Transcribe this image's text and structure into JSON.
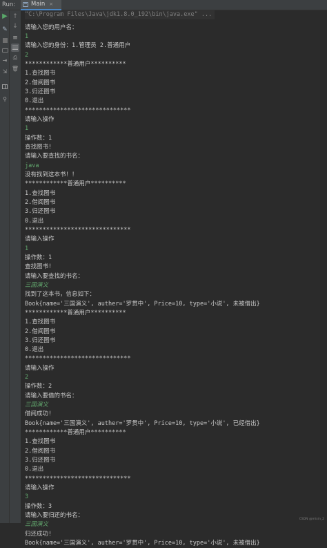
{
  "run_label": "Run:",
  "tab": {
    "label": "Main",
    "close": "×"
  },
  "watermark": "CSDN @mixin_2",
  "console_lines": [
    {
      "text": "\"C:\\Program Files\\Java\\jdk1.8.0_192\\bin\\java.exe\" ...",
      "kind": "cmd"
    },
    {
      "text": "请输入您的用户名：",
      "kind": "out"
    },
    {
      "text": "1",
      "kind": "input"
    },
    {
      "text": "请输入您的身份：1.管理员 2.普通用户",
      "kind": "out"
    },
    {
      "text": "2",
      "kind": "input"
    },
    {
      "text": "************普通用户**********",
      "kind": "out"
    },
    {
      "text": "1.查找图书",
      "kind": "out"
    },
    {
      "text": "2.借阅图书",
      "kind": "out"
    },
    {
      "text": "3.归还图书",
      "kind": "out"
    },
    {
      "text": "0.退出",
      "kind": "out"
    },
    {
      "text": "******************************",
      "kind": "out"
    },
    {
      "text": "请输入操作",
      "kind": "out"
    },
    {
      "text": "1",
      "kind": "input"
    },
    {
      "text": "操作数：1",
      "kind": "out"
    },
    {
      "text": "查找图书!",
      "kind": "out"
    },
    {
      "text": "请输入要查找的书名：",
      "kind": "out"
    },
    {
      "text": "java",
      "kind": "input"
    },
    {
      "text": "没有找到这本书！！",
      "kind": "out"
    },
    {
      "text": "************普通用户**********",
      "kind": "out"
    },
    {
      "text": "1.查找图书",
      "kind": "out"
    },
    {
      "text": "2.借阅图书",
      "kind": "out"
    },
    {
      "text": "3.归还图书",
      "kind": "out"
    },
    {
      "text": "0.退出",
      "kind": "out"
    },
    {
      "text": "******************************",
      "kind": "out"
    },
    {
      "text": "请输入操作",
      "kind": "out"
    },
    {
      "text": "1",
      "kind": "input"
    },
    {
      "text": "操作数：1",
      "kind": "out"
    },
    {
      "text": "查找图书!",
      "kind": "out"
    },
    {
      "text": "请输入要查找的书名：",
      "kind": "out"
    },
    {
      "text": "三国演义",
      "kind": "input-italic"
    },
    {
      "text": "找到了这本书，信息如下：",
      "kind": "out"
    },
    {
      "text": "Book{name='三国演义', auther='罗贯中', Price=10, type='小说', 未被借出}",
      "kind": "out"
    },
    {
      "text": "************普通用户**********",
      "kind": "out"
    },
    {
      "text": "1.查找图书",
      "kind": "out"
    },
    {
      "text": "2.借阅图书",
      "kind": "out"
    },
    {
      "text": "3.归还图书",
      "kind": "out"
    },
    {
      "text": "0.退出",
      "kind": "out"
    },
    {
      "text": "******************************",
      "kind": "out"
    },
    {
      "text": "请输入操作",
      "kind": "out"
    },
    {
      "text": "2",
      "kind": "input"
    },
    {
      "text": "操作数：2",
      "kind": "out"
    },
    {
      "text": "请输入要借的书名：",
      "kind": "out"
    },
    {
      "text": "三国演义",
      "kind": "input-italic"
    },
    {
      "text": "借阅成功!",
      "kind": "out"
    },
    {
      "text": "Book{name='三国演义', auther='罗贯中', Price=10, type='小说', 已经借出}",
      "kind": "out"
    },
    {
      "text": "************普通用户**********",
      "kind": "out"
    },
    {
      "text": "1.查找图书",
      "kind": "out"
    },
    {
      "text": "2.借阅图书",
      "kind": "out"
    },
    {
      "text": "3.归还图书",
      "kind": "out"
    },
    {
      "text": "0.退出",
      "kind": "out"
    },
    {
      "text": "******************************",
      "kind": "out"
    },
    {
      "text": "请输入操作",
      "kind": "out"
    },
    {
      "text": "3",
      "kind": "input"
    },
    {
      "text": "操作数：3",
      "kind": "out"
    },
    {
      "text": "请输入要归还的书名：",
      "kind": "out"
    },
    {
      "text": "三国演义",
      "kind": "input-italic"
    },
    {
      "text": "归还成功!",
      "kind": "out"
    },
    {
      "text": "Book{name='三国演义', auther='罗贯中', Price=10, type='小说', 未被借出}",
      "kind": "out"
    }
  ]
}
